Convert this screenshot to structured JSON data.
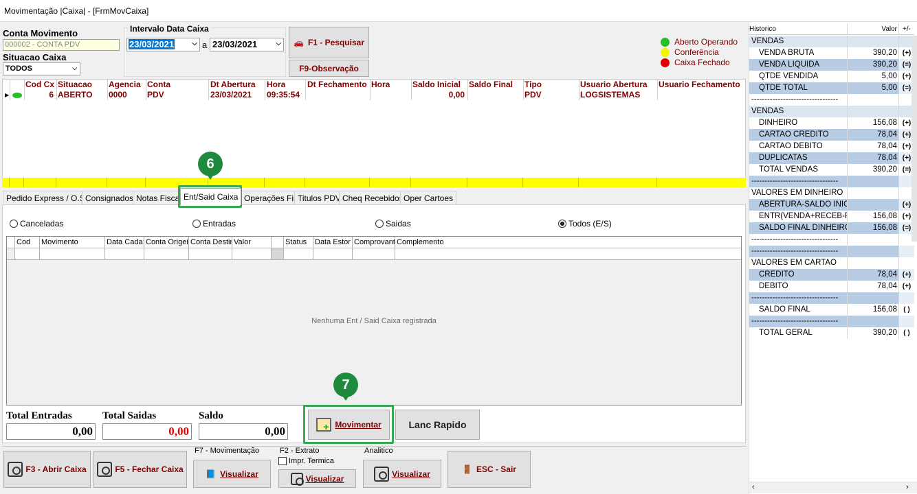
{
  "window": {
    "title": "Movimentação |Caixa| - [FrmMovCaixa]"
  },
  "filters": {
    "conta_label": "Conta Movimento",
    "conta_value": "000002 - CONTA PDV",
    "situacao_label": "Situacao Caixa",
    "situacao_value": "TODOS",
    "intervalo_label": "Intervalo Data Caixa",
    "date_from": "23/03/2021",
    "date_sep": "a",
    "date_to": "23/03/2021",
    "pesquisar": "F1 - Pesquisar",
    "observacao": "F9-Observação"
  },
  "legend": [
    {
      "label": "Aberto Operando",
      "color": "#22c022"
    },
    {
      "label": "Conferência",
      "color": "#f5f500"
    },
    {
      "label": "Caixa Fechado",
      "color": "#e00000"
    }
  ],
  "caixa_grid": {
    "headers": [
      "Cod Cx",
      "Situacao",
      "Agencia",
      "Conta",
      "Dt Abertura",
      "Hora",
      "Dt Fechamento",
      "Hora",
      "Saldo Inicial",
      "Saldo Final",
      "Tipo",
      "Usuario Abertura",
      "Usuario Fechamento"
    ],
    "row": [
      "6",
      "ABERTO",
      "0000",
      "PDV",
      "23/03/2021",
      "09:35:54",
      "",
      "",
      "0,00",
      "",
      "PDV",
      "LOGSISTEMAS",
      ""
    ]
  },
  "tabs": [
    "Pedido Express / O.S",
    "Consignados",
    "Notas Fiscais",
    "Ent/Said Caixa",
    "Operações Fin",
    "Titulos PDV",
    "Cheq Recebidos",
    "Oper Cartoes"
  ],
  "radios": {
    "canceladas": "Canceladas",
    "entradas": "Entradas",
    "saidas": "Saidas",
    "todos": "Todos (E/S)",
    "selected": "todos"
  },
  "mov_grid": {
    "headers": [
      "Cod",
      "Movimento",
      "Data Cada:",
      "Conta Origei",
      "Conta Destir",
      "Valor",
      "",
      "Status",
      "Data Estor",
      "Comprovant",
      "Complemento"
    ],
    "empty_msg": "Nenhuma Ent / Said Caixa registrada"
  },
  "totals": {
    "entradas_label": "Total Entradas",
    "entradas": "0,00",
    "saidas_label": "Total Saidas",
    "saidas": "0,00",
    "saldo_label": "Saldo",
    "saldo": "0,00"
  },
  "steps": {
    "s6": "6",
    "s7": "7"
  },
  "actions": {
    "movimentar": "Movimentar",
    "lanc_rapido": "Lanc Rapido"
  },
  "bottom": {
    "abrir": "F3 - Abrir Caixa",
    "fechar": "F5 - Fechar Caixa",
    "f7_label": "F7 - Movimentação",
    "f2_label": "F2 - Extrato",
    "impr": "Impr. Termica",
    "analitico_label": "Analitico",
    "visualizar": "Visualizar",
    "sair": "ESC - Sair"
  },
  "historico": {
    "col_hist": "Historico",
    "col_valor": "Valor",
    "col_sign": "+/-",
    "rows": [
      {
        "label": "VENDAS",
        "value": "",
        "sign": "",
        "style": "sec",
        "indent": false
      },
      {
        "label": "VENDA BRUTA",
        "value": "390,20",
        "sign": "(+)",
        "style": "plain",
        "indent": true
      },
      {
        "label": "VENDA LIQUIDA",
        "value": "390,20",
        "sign": "(=)",
        "style": "blue",
        "indent": true
      },
      {
        "label": "QTDE VENDIDA",
        "value": "5,00",
        "sign": "(+)",
        "style": "plain",
        "indent": true
      },
      {
        "label": "QTDE TOTAL",
        "value": "5,00",
        "sign": "(=)",
        "style": "blue",
        "indent": true
      },
      {
        "label": "---------------------------------",
        "value": "",
        "sign": "",
        "style": "plain",
        "indent": false
      },
      {
        "label": "VENDAS",
        "value": "",
        "sign": "",
        "style": "sec",
        "indent": false
      },
      {
        "label": "DINHEIRO",
        "value": "156,08",
        "sign": "(+)",
        "style": "plain",
        "indent": true
      },
      {
        "label": "CARTAO CREDITO",
        "value": "78,04",
        "sign": "(+)",
        "style": "blue",
        "indent": true
      },
      {
        "label": "CARTAO DEBITO",
        "value": "78,04",
        "sign": "(+)",
        "style": "plain",
        "indent": true
      },
      {
        "label": "DUPLICATAS",
        "value": "78,04",
        "sign": "(+)",
        "style": "blue",
        "indent": true
      },
      {
        "label": "TOTAL VENDAS",
        "value": "390,20",
        "sign": "(=)",
        "style": "plain",
        "indent": true
      },
      {
        "label": "---------------------------------",
        "value": "",
        "sign": "",
        "style": "blue",
        "indent": false
      },
      {
        "label": "VALORES EM DINHEIRO",
        "value": "",
        "sign": "",
        "style": "plain",
        "indent": false
      },
      {
        "label": "ABERTURA-SALDO INICIAL",
        "value": "",
        "sign": "(+)",
        "style": "blue",
        "indent": true
      },
      {
        "label": "ENTR(VENDA+RECEB-PGTO)",
        "value": "156,08",
        "sign": "(+)",
        "style": "plain",
        "indent": true
      },
      {
        "label": "SALDO FINAL DINHEIRO",
        "value": "156,08",
        "sign": "(=)",
        "style": "blue",
        "indent": true
      },
      {
        "label": "---------------------------------",
        "value": "",
        "sign": "",
        "style": "plain",
        "indent": false
      },
      {
        "label": "---------------------------------",
        "value": "",
        "sign": "",
        "style": "blue",
        "indent": false
      },
      {
        "label": "VALORES EM CARTAO",
        "value": "",
        "sign": "",
        "style": "plain",
        "indent": false
      },
      {
        "label": "CREDITO",
        "value": "78,04",
        "sign": "(+)",
        "style": "blue",
        "indent": true
      },
      {
        "label": "DEBITO",
        "value": "78,04",
        "sign": "(+)",
        "style": "plain",
        "indent": true
      },
      {
        "label": "---------------------------------",
        "value": "",
        "sign": "",
        "style": "blue",
        "indent": false
      },
      {
        "label": "SALDO FINAL",
        "value": "156,08",
        "sign": "( )",
        "style": "plain",
        "indent": true
      },
      {
        "label": "---------------------------------",
        "value": "",
        "sign": "",
        "style": "blue",
        "indent": false
      },
      {
        "label": "TOTAL GERAL",
        "value": "390,20",
        "sign": "( )",
        "style": "plain",
        "indent": true
      }
    ]
  }
}
